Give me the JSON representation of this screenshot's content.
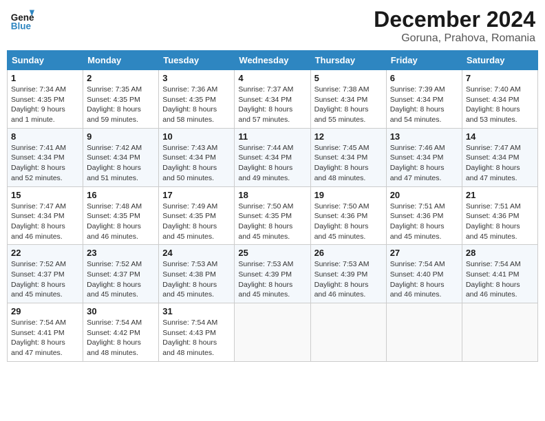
{
  "header": {
    "logo_line1": "General",
    "logo_line2": "Blue",
    "month": "December 2024",
    "location": "Goruna, Prahova, Romania"
  },
  "weekdays": [
    "Sunday",
    "Monday",
    "Tuesday",
    "Wednesday",
    "Thursday",
    "Friday",
    "Saturday"
  ],
  "weeks": [
    [
      {
        "day": "1",
        "sunrise": "Sunrise: 7:34 AM",
        "sunset": "Sunset: 4:35 PM",
        "daylight": "Daylight: 9 hours and 1 minute."
      },
      {
        "day": "2",
        "sunrise": "Sunrise: 7:35 AM",
        "sunset": "Sunset: 4:35 PM",
        "daylight": "Daylight: 8 hours and 59 minutes."
      },
      {
        "day": "3",
        "sunrise": "Sunrise: 7:36 AM",
        "sunset": "Sunset: 4:35 PM",
        "daylight": "Daylight: 8 hours and 58 minutes."
      },
      {
        "day": "4",
        "sunrise": "Sunrise: 7:37 AM",
        "sunset": "Sunset: 4:34 PM",
        "daylight": "Daylight: 8 hours and 57 minutes."
      },
      {
        "day": "5",
        "sunrise": "Sunrise: 7:38 AM",
        "sunset": "Sunset: 4:34 PM",
        "daylight": "Daylight: 8 hours and 55 minutes."
      },
      {
        "day": "6",
        "sunrise": "Sunrise: 7:39 AM",
        "sunset": "Sunset: 4:34 PM",
        "daylight": "Daylight: 8 hours and 54 minutes."
      },
      {
        "day": "7",
        "sunrise": "Sunrise: 7:40 AM",
        "sunset": "Sunset: 4:34 PM",
        "daylight": "Daylight: 8 hours and 53 minutes."
      }
    ],
    [
      {
        "day": "8",
        "sunrise": "Sunrise: 7:41 AM",
        "sunset": "Sunset: 4:34 PM",
        "daylight": "Daylight: 8 hours and 52 minutes."
      },
      {
        "day": "9",
        "sunrise": "Sunrise: 7:42 AM",
        "sunset": "Sunset: 4:34 PM",
        "daylight": "Daylight: 8 hours and 51 minutes."
      },
      {
        "day": "10",
        "sunrise": "Sunrise: 7:43 AM",
        "sunset": "Sunset: 4:34 PM",
        "daylight": "Daylight: 8 hours and 50 minutes."
      },
      {
        "day": "11",
        "sunrise": "Sunrise: 7:44 AM",
        "sunset": "Sunset: 4:34 PM",
        "daylight": "Daylight: 8 hours and 49 minutes."
      },
      {
        "day": "12",
        "sunrise": "Sunrise: 7:45 AM",
        "sunset": "Sunset: 4:34 PM",
        "daylight": "Daylight: 8 hours and 48 minutes."
      },
      {
        "day": "13",
        "sunrise": "Sunrise: 7:46 AM",
        "sunset": "Sunset: 4:34 PM",
        "daylight": "Daylight: 8 hours and 47 minutes."
      },
      {
        "day": "14",
        "sunrise": "Sunrise: 7:47 AM",
        "sunset": "Sunset: 4:34 PM",
        "daylight": "Daylight: 8 hours and 47 minutes."
      }
    ],
    [
      {
        "day": "15",
        "sunrise": "Sunrise: 7:47 AM",
        "sunset": "Sunset: 4:34 PM",
        "daylight": "Daylight: 8 hours and 46 minutes."
      },
      {
        "day": "16",
        "sunrise": "Sunrise: 7:48 AM",
        "sunset": "Sunset: 4:35 PM",
        "daylight": "Daylight: 8 hours and 46 minutes."
      },
      {
        "day": "17",
        "sunrise": "Sunrise: 7:49 AM",
        "sunset": "Sunset: 4:35 PM",
        "daylight": "Daylight: 8 hours and 45 minutes."
      },
      {
        "day": "18",
        "sunrise": "Sunrise: 7:50 AM",
        "sunset": "Sunset: 4:35 PM",
        "daylight": "Daylight: 8 hours and 45 minutes."
      },
      {
        "day": "19",
        "sunrise": "Sunrise: 7:50 AM",
        "sunset": "Sunset: 4:36 PM",
        "daylight": "Daylight: 8 hours and 45 minutes."
      },
      {
        "day": "20",
        "sunrise": "Sunrise: 7:51 AM",
        "sunset": "Sunset: 4:36 PM",
        "daylight": "Daylight: 8 hours and 45 minutes."
      },
      {
        "day": "21",
        "sunrise": "Sunrise: 7:51 AM",
        "sunset": "Sunset: 4:36 PM",
        "daylight": "Daylight: 8 hours and 45 minutes."
      }
    ],
    [
      {
        "day": "22",
        "sunrise": "Sunrise: 7:52 AM",
        "sunset": "Sunset: 4:37 PM",
        "daylight": "Daylight: 8 hours and 45 minutes."
      },
      {
        "day": "23",
        "sunrise": "Sunrise: 7:52 AM",
        "sunset": "Sunset: 4:37 PM",
        "daylight": "Daylight: 8 hours and 45 minutes."
      },
      {
        "day": "24",
        "sunrise": "Sunrise: 7:53 AM",
        "sunset": "Sunset: 4:38 PM",
        "daylight": "Daylight: 8 hours and 45 minutes."
      },
      {
        "day": "25",
        "sunrise": "Sunrise: 7:53 AM",
        "sunset": "Sunset: 4:39 PM",
        "daylight": "Daylight: 8 hours and 45 minutes."
      },
      {
        "day": "26",
        "sunrise": "Sunrise: 7:53 AM",
        "sunset": "Sunset: 4:39 PM",
        "daylight": "Daylight: 8 hours and 46 minutes."
      },
      {
        "day": "27",
        "sunrise": "Sunrise: 7:54 AM",
        "sunset": "Sunset: 4:40 PM",
        "daylight": "Daylight: 8 hours and 46 minutes."
      },
      {
        "day": "28",
        "sunrise": "Sunrise: 7:54 AM",
        "sunset": "Sunset: 4:41 PM",
        "daylight": "Daylight: 8 hours and 46 minutes."
      }
    ],
    [
      {
        "day": "29",
        "sunrise": "Sunrise: 7:54 AM",
        "sunset": "Sunset: 4:41 PM",
        "daylight": "Daylight: 8 hours and 47 minutes."
      },
      {
        "day": "30",
        "sunrise": "Sunrise: 7:54 AM",
        "sunset": "Sunset: 4:42 PM",
        "daylight": "Daylight: 8 hours and 48 minutes."
      },
      {
        "day": "31",
        "sunrise": "Sunrise: 7:54 AM",
        "sunset": "Sunset: 4:43 PM",
        "daylight": "Daylight: 8 hours and 48 minutes."
      },
      null,
      null,
      null,
      null
    ]
  ]
}
